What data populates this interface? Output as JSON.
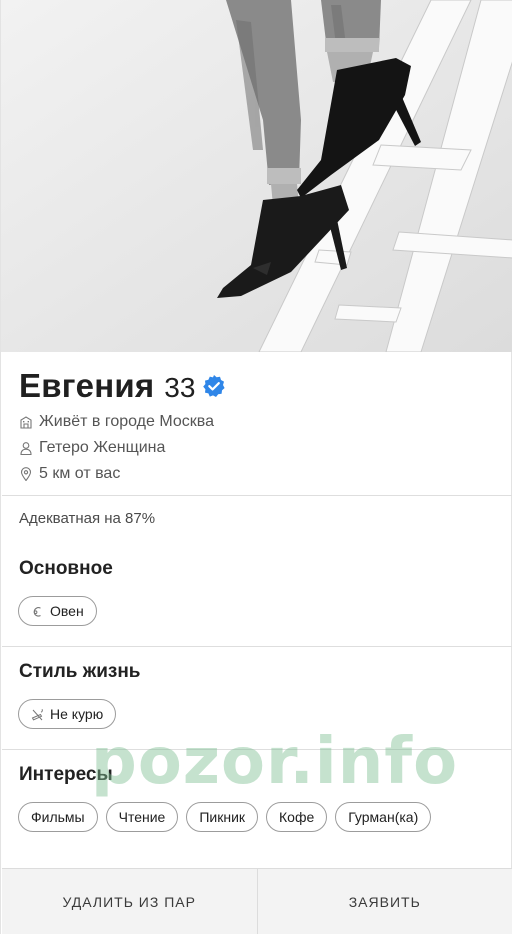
{
  "profile": {
    "name": "Евгения",
    "age": "33",
    "location": "Живёт в городе Москва",
    "orientation": "Гетеро Женщина",
    "distance": "5 км от вас",
    "adequacy": "Адекватная на 87%"
  },
  "sections": {
    "main": {
      "title": "Основное",
      "chips": [
        {
          "label": "Овен",
          "icon": "zodiac-icon"
        }
      ]
    },
    "lifestyle": {
      "title": "Стиль жизнь",
      "chips": [
        {
          "label": "Не курю",
          "icon": "no-smoking-icon"
        }
      ]
    },
    "interests": {
      "title": "Интересы",
      "chips": [
        "Фильмы",
        "Чтение",
        "Пикник",
        "Кофе",
        "Гурман(ка)"
      ]
    }
  },
  "actions": {
    "remove": "УДАЛИТЬ ИЗ ПАР",
    "report": "ЗАЯВИТЬ"
  },
  "watermark": "pozor.info",
  "colors": {
    "verified": "#2f86e8",
    "watermark": "#7fbf93"
  }
}
